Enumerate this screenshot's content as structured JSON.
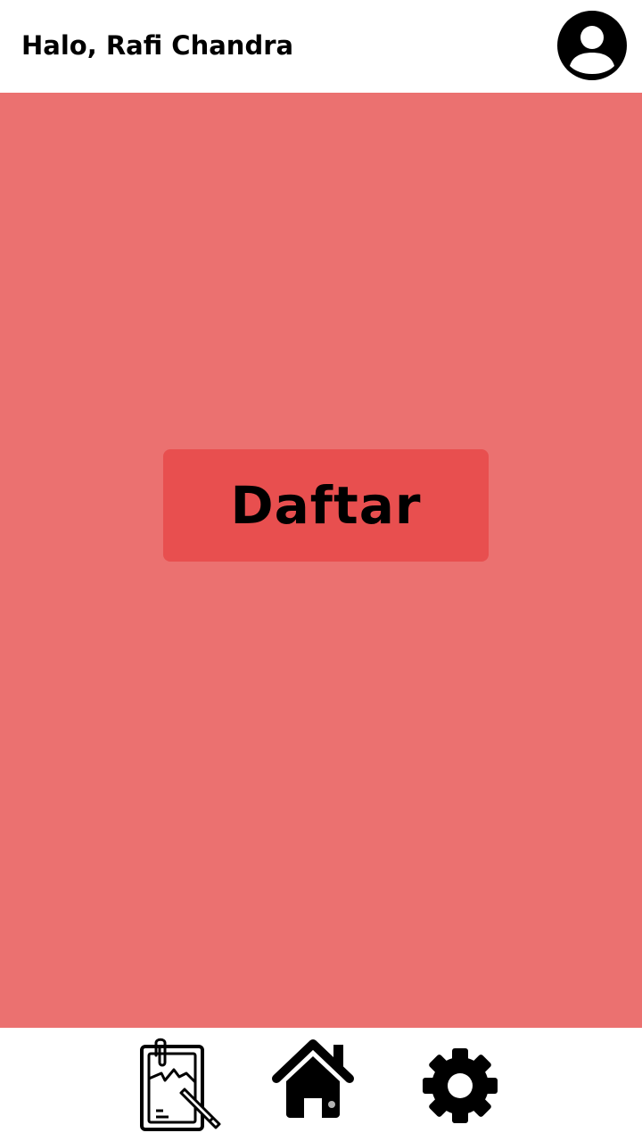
{
  "header": {
    "greeting": "Halo, Rafi Chandra",
    "avatar_icon": "account-circle-icon"
  },
  "main": {
    "background_color": "#eb7170",
    "register_button": {
      "label": "Daftar",
      "color": "#e84f4f"
    }
  },
  "bottom_nav": {
    "items": [
      {
        "icon": "clipboard-form-icon"
      },
      {
        "icon": "home-icon"
      },
      {
        "icon": "gear-icon"
      }
    ]
  }
}
